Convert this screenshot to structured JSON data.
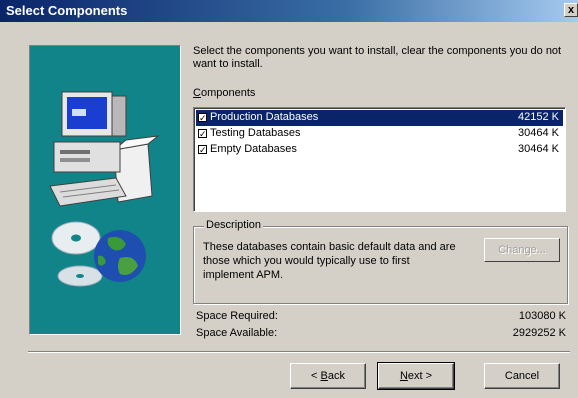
{
  "window": {
    "title": "Select Components",
    "close_label": "x"
  },
  "intro_text": "Select the components you want to install, clear the components you do not want to install.",
  "components": {
    "label_first": "C",
    "label_rest": "omponents",
    "items": [
      {
        "name": "Production Databases",
        "size": "42152 K",
        "checked": true,
        "selected": true
      },
      {
        "name": "Testing Databases",
        "size": "30464 K",
        "checked": true,
        "selected": false
      },
      {
        "name": "Empty Databases",
        "size": "30464 K",
        "checked": true,
        "selected": false
      }
    ]
  },
  "description": {
    "legend": "Description",
    "text": "These databases contain basic default data and are those which you would typically use to first implement APM.",
    "change_button": "Change..."
  },
  "space": {
    "required_label": "Space Required:",
    "required_value": "103080 K",
    "available_label": "Space Available:",
    "available_value": "2929252 K"
  },
  "buttons": {
    "back_prefix": "< ",
    "back_ul": "B",
    "back_rest": "ack",
    "next_ul": "N",
    "next_rest": "ext >",
    "cancel": "Cancel"
  },
  "colors": {
    "titlebar": "#0a246a",
    "panel": "#108488",
    "selection": "#0a246a",
    "face": "#d4d0c8"
  },
  "icons": [
    "computer-icon",
    "cd-disc-icon",
    "globe-icon",
    "checkmark-icon"
  ]
}
